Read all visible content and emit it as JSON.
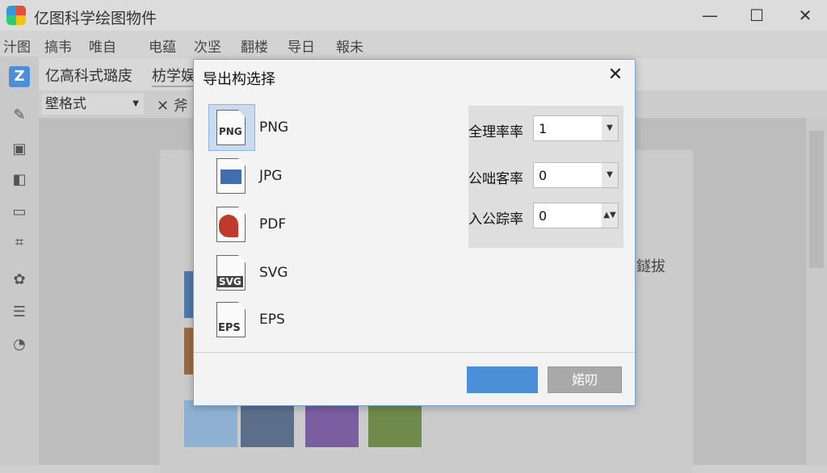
{
  "app": {
    "title": "亿图科学绘图物件"
  },
  "window_controls": {
    "minimize": "—",
    "maximize": "☐",
    "close": "✕"
  },
  "menu": [
    "汁图",
    "搞韦",
    "唯自",
    "电蕴",
    "次坚",
    "翻楼",
    "导日",
    "報未"
  ],
  "left_tools": [
    "letter-z-icon",
    "paint-icon",
    "frame-icon",
    "shapes-icon",
    "monitor-icon",
    "crop-icon",
    "color-palette-icon",
    "layout-icon",
    "chart-icon"
  ],
  "tabs": [
    {
      "label": "亿高科式璐庋"
    },
    {
      "label": "枋学娱"
    }
  ],
  "format_bar": {
    "style_select": "壁格式",
    "fragment": "✕ 斧"
  },
  "background_fragment": "鐩拔",
  "dialog": {
    "title": "导出构选择",
    "close": "✕",
    "formats": [
      {
        "name": "PNG",
        "icon": "png-file-icon",
        "badge": "PNG",
        "selected": true
      },
      {
        "name": "JPG",
        "icon": "jpg-file-icon",
        "badge": "",
        "selected": false
      },
      {
        "name": "PDF",
        "icon": "pdf-file-icon",
        "badge": "",
        "selected": false
      },
      {
        "name": "SVG",
        "icon": "svg-file-icon",
        "badge": "SVG",
        "selected": false
      },
      {
        "name": "EPS",
        "icon": "eps-file-icon",
        "badge": "EPS",
        "selected": false
      }
    ],
    "settings": [
      {
        "label": "全理率率",
        "value": "1"
      },
      {
        "label": "公咄客率",
        "value": "0"
      },
      {
        "label": "入公踪率",
        "value": "0"
      }
    ],
    "ok_label": "",
    "cancel_label": "婼叨"
  },
  "colors": {
    "accent": "#4a8fd8",
    "dialog_bg": "#f3f3f3",
    "cancel_bg": "#a9a9a9"
  }
}
